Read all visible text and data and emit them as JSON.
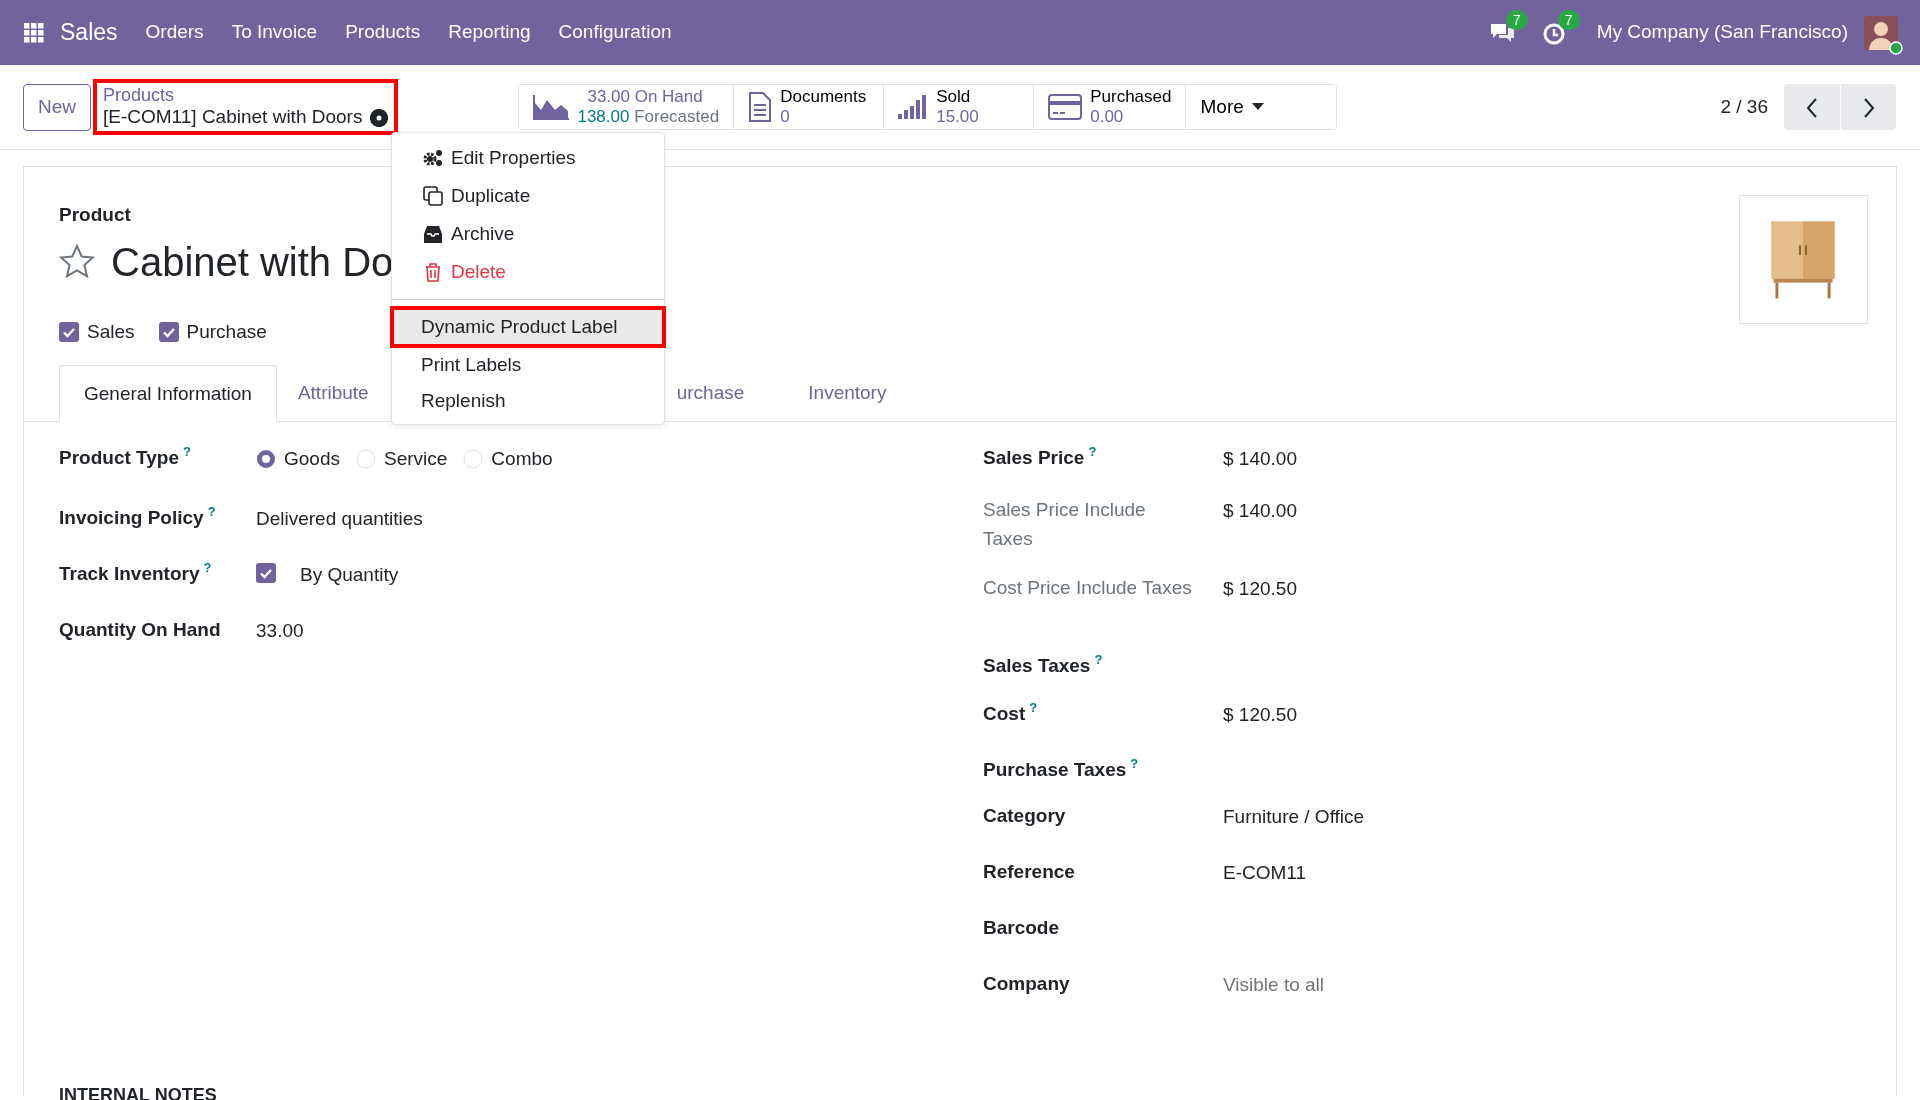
{
  "navbar": {
    "app": "Sales",
    "menu": [
      "Orders",
      "To Invoice",
      "Products",
      "Reporting",
      "Configuration"
    ],
    "chat_badge": "7",
    "activity_badge": "7",
    "company": "My Company (San Francisco)",
    "user_online": true
  },
  "control_panel": {
    "new_button": "New",
    "breadcrumb": {
      "parent": "Products",
      "current": "[E-COM11] Cabinet with Doors",
      "highlighted": true
    },
    "stat_buttons": [
      {
        "kind": "forecast",
        "value": "33.00",
        "label": "On Hand",
        "value2": "138.00",
        "label2": "Forecasted"
      },
      {
        "kind": "documents",
        "label": "Documents",
        "value": "0"
      },
      {
        "kind": "sold",
        "label": "Sold",
        "value": "15.00"
      },
      {
        "kind": "purchased",
        "label": "Purchased",
        "value": "0.00"
      }
    ],
    "more": "More",
    "pager": "2 / 36"
  },
  "action_menu": {
    "groups": [
      [
        {
          "kind": "properties",
          "label": "Edit Properties",
          "danger": false,
          "selected": false,
          "highlighted": false
        },
        {
          "kind": "duplicate",
          "label": "Duplicate",
          "danger": false,
          "selected": false,
          "highlighted": false
        },
        {
          "kind": "archive",
          "label": "Archive",
          "danger": false,
          "selected": false,
          "highlighted": false
        },
        {
          "kind": "delete",
          "label": "Delete",
          "danger": true,
          "selected": false,
          "highlighted": false
        }
      ],
      [
        {
          "kind": "action",
          "label": "Dynamic Product Label",
          "danger": false,
          "selected": true,
          "highlighted": true
        },
        {
          "kind": "action",
          "label": "Print Labels",
          "danger": false,
          "selected": false,
          "highlighted": false
        },
        {
          "kind": "action",
          "label": "Replenish",
          "danger": false,
          "selected": false,
          "highlighted": false
        }
      ]
    ]
  },
  "form": {
    "record_label": "Product",
    "title": "Cabinet with Do",
    "favorite": false,
    "flags": [
      {
        "label": "Sales",
        "checked": true
      },
      {
        "label": "Purchase",
        "checked": true
      }
    ],
    "tabs": [
      {
        "label": "General Information",
        "selected": true
      },
      {
        "label": "Attribute",
        "selected": false
      },
      {
        "label": "urchase",
        "selected": false
      },
      {
        "label": "Inventory",
        "selected": false
      }
    ],
    "left_fields": [
      {
        "label": "Product Type",
        "help": "?",
        "kind": "radio",
        "options": [
          {
            "label": "Goods",
            "selected": true
          },
          {
            "label": "Service",
            "selected": false
          },
          {
            "label": "Combo",
            "selected": false
          }
        ]
      },
      {
        "label": "Invoicing Policy",
        "help": "?",
        "kind": "text",
        "value": "Delivered quantities"
      },
      {
        "label": "Track Inventory",
        "help": "?",
        "kind": "checkbox",
        "checked": true,
        "value": "By Quantity"
      },
      {
        "label": "Quantity On Hand",
        "kind": "text",
        "value": "33.00"
      }
    ],
    "right_fields": [
      {
        "label": "Sales Price",
        "help": "?",
        "kind": "text",
        "value": "$ 140.00"
      },
      {
        "label": "Sales Price Include Taxes",
        "muted": true,
        "kind": "text",
        "value": "$ 140.00"
      },
      {
        "label": "Cost Price Include Taxes",
        "muted": true,
        "kind": "text",
        "value": "$ 120.50"
      },
      {
        "label": "Sales Taxes",
        "help": "?",
        "kind": "empty"
      },
      {
        "label": "Cost",
        "help": "?",
        "kind": "text",
        "value": "$ 120.50"
      },
      {
        "label": "Purchase Taxes",
        "help": "?",
        "kind": "empty"
      },
      {
        "label": "Category",
        "kind": "text",
        "value": "Furniture / Office"
      },
      {
        "label": "Reference",
        "kind": "text",
        "value": "E-COM11"
      },
      {
        "label": "Barcode",
        "kind": "empty"
      },
      {
        "label": "Company",
        "kind": "placeholder",
        "placeholder": "Visible to all"
      }
    ],
    "notes_heading": "INTERNAL NOTES"
  }
}
